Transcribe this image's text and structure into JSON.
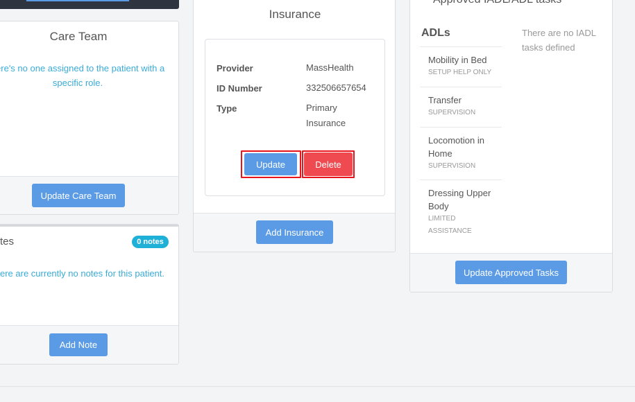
{
  "care_team": {
    "title": "Care Team",
    "message": "here's no one assigned to the patient with a specific role.",
    "button": "Update Care Team"
  },
  "notes": {
    "title": "tes",
    "badge": "0 notes",
    "message": "ere are currently no notes for this patient.",
    "button": "Add Note"
  },
  "insurance": {
    "title": "Insurance",
    "rows": [
      {
        "label": "Provider",
        "value": "MassHealth"
      },
      {
        "label": "ID Number",
        "value": "332506657654"
      },
      {
        "label": "Type",
        "value": "Primary Insurance"
      }
    ],
    "update_button": "Update",
    "delete_button": "Delete",
    "add_button": "Add Insurance"
  },
  "tasks": {
    "title": "Approved IADL/ADL tasks",
    "adl_heading": "ADLs",
    "iadl_message": "There are no IADL tasks defined",
    "adls": [
      {
        "name": "Mobility in Bed",
        "level": "SETUP HELP ONLY"
      },
      {
        "name": "Transfer",
        "level": "SUPERVISION"
      },
      {
        "name": "Locomotion in Home",
        "level": "SUPERVISION"
      },
      {
        "name": "Dressing Upper Body",
        "level": "LIMITED ASSISTANCE"
      }
    ],
    "button": "Update Approved Tasks"
  },
  "colors": {
    "primary": "#5b9be6",
    "danger": "#ee4a4f",
    "highlight": "#e8131b",
    "info": "#1fb0d8"
  }
}
